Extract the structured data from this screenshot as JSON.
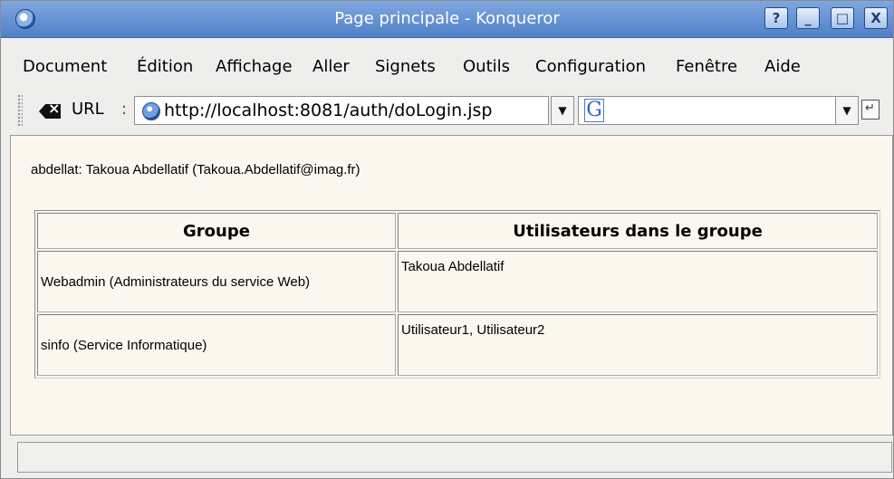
{
  "window": {
    "title": "Page principale - Konqueror",
    "buttons": {
      "help": "?",
      "minimize": "_",
      "maximize": "□",
      "close": "X"
    }
  },
  "menu": [
    "Document",
    "Édition",
    "Affichage",
    "Aller",
    "Signets",
    "Outils",
    "Configuration",
    "Fenêtre",
    "Aide"
  ],
  "toolbar": {
    "url_label": "URL",
    "url_colon": ":",
    "url_value": "http://localhost:8081/auth/doLogin.jsp",
    "search_value": "",
    "search_engine_icon": "G"
  },
  "page": {
    "user_line": "abdellat: Takoua Abdellatif (Takoua.Abdellatif@imag.fr)",
    "table": {
      "headers": [
        "Groupe",
        "Utilisateurs dans le groupe"
      ],
      "rows": [
        {
          "group": "Webadmin (Administrateurs du service Web)",
          "users": "Takoua Abdellatif"
        },
        {
          "group": "sinfo (Service Informatique)",
          "users": "Utilisateur1, Utilisateur2"
        }
      ]
    }
  },
  "status": {
    "text": ""
  },
  "colors": {
    "titlebar": "#5f8fd3",
    "content_bg": "#fcf7ee",
    "chrome_bg": "#eeeeec"
  }
}
